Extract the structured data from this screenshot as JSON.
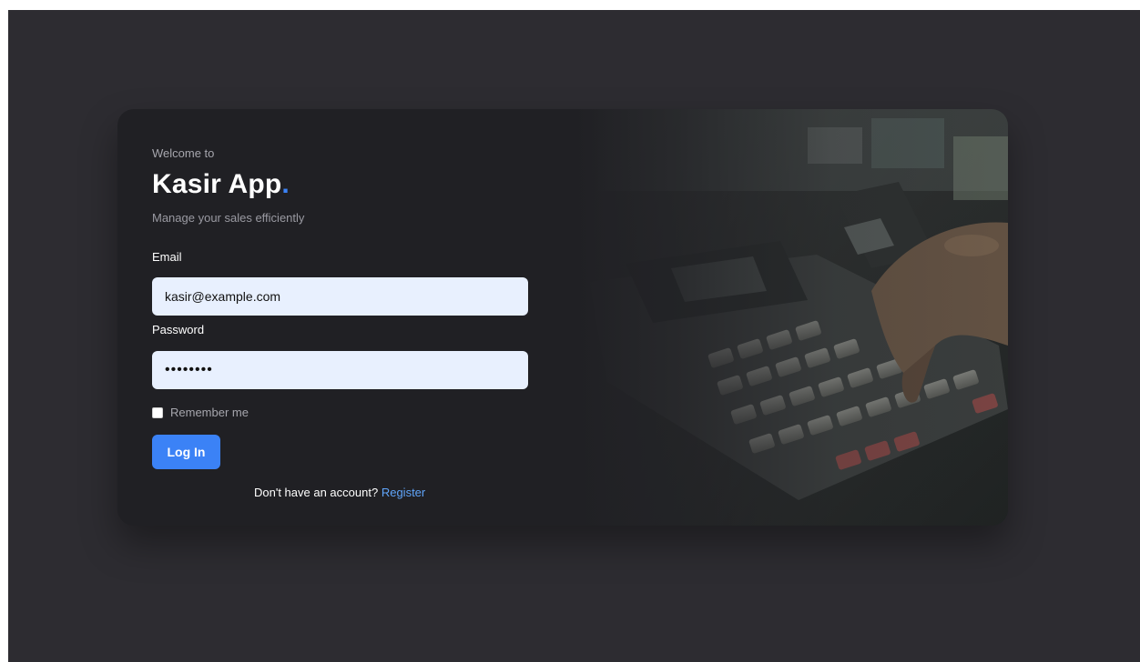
{
  "login": {
    "welcome": "Welcome to",
    "app_name": "Kasir App",
    "app_dot": ".",
    "tagline": "Manage your sales efficiently",
    "email_label": "Email",
    "email_value": "kasir@example.com",
    "password_label": "Password",
    "password_value": "password",
    "remember_label": "Remember me",
    "remember_checked": false,
    "login_button": "Log In",
    "no_account_text": "Don't have an account?",
    "register_link": "Register"
  },
  "hero_image": {
    "subject": "cash-register-keypad-photo"
  },
  "colors": {
    "page_bg": "#2d2c31",
    "card_bg": "#202024",
    "accent": "#3b82f6",
    "link": "#60a5fa",
    "input_bg": "#e8f0fe"
  }
}
